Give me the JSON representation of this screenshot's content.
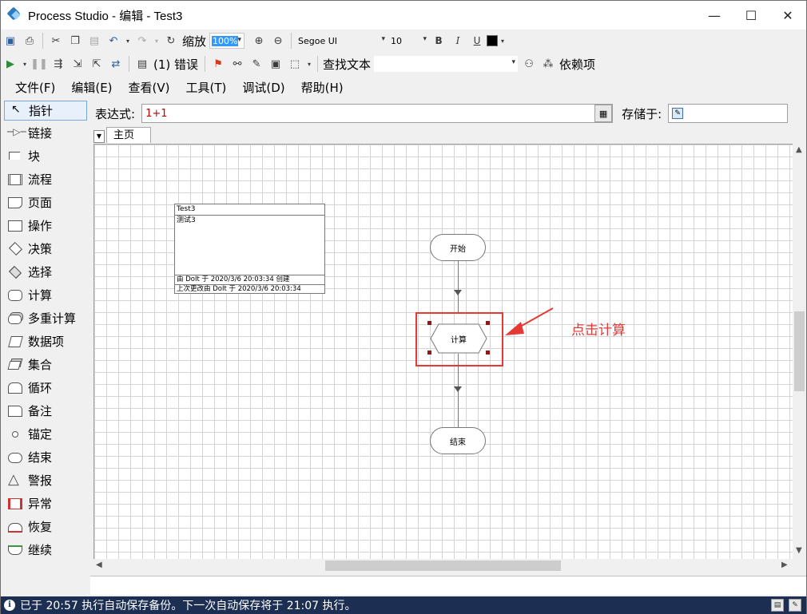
{
  "window": {
    "title": "Process Studio  - 编辑 - Test3",
    "minimize": "—",
    "maximize": "☐",
    "close": "✕"
  },
  "toolbar1": {
    "zoom_label": "缩放",
    "zoom_value": "100%",
    "font_name": "Segoe UI",
    "font_size": "10",
    "bold": "B",
    "italic": "I",
    "underline": "U"
  },
  "toolbar2": {
    "errors_label": "(1) 错误",
    "find_label": "查找文本",
    "find_value": "",
    "dependencies_label": "依赖项"
  },
  "menu": [
    "文件(F)",
    "编辑(E)",
    "查看(V)",
    "工具(T)",
    "调试(D)",
    "帮助(H)"
  ],
  "palette": [
    {
      "label": "指针",
      "icon": "pointer-icon"
    },
    {
      "label": "链接",
      "icon": "link-icon"
    },
    {
      "label": "块",
      "icon": "block-icon"
    },
    {
      "label": "流程",
      "icon": "process-icon"
    },
    {
      "label": "页面",
      "icon": "page-icon"
    },
    {
      "label": "操作",
      "icon": "action-icon"
    },
    {
      "label": "决策",
      "icon": "decision-icon"
    },
    {
      "label": "选择",
      "icon": "choice-icon"
    },
    {
      "label": "计算",
      "icon": "calculation-icon"
    },
    {
      "label": "多重计算",
      "icon": "multi-calculation-icon"
    },
    {
      "label": "数据项",
      "icon": "data-item-icon"
    },
    {
      "label": "集合",
      "icon": "collection-icon"
    },
    {
      "label": "循环",
      "icon": "loop-icon"
    },
    {
      "label": "备注",
      "icon": "note-icon"
    },
    {
      "label": "锚定",
      "icon": "anchor-icon"
    },
    {
      "label": "结束",
      "icon": "end-icon"
    },
    {
      "label": "警报",
      "icon": "alert-icon"
    },
    {
      "label": "异常",
      "icon": "exception-icon"
    },
    {
      "label": "恢复",
      "icon": "recover-icon"
    },
    {
      "label": "继续",
      "icon": "resume-icon"
    }
  ],
  "expression": {
    "label": "表达式:",
    "value": "1+1",
    "store_label": "存储于:",
    "store_value": ""
  },
  "tabs": [
    "主页"
  ],
  "canvas": {
    "info_box": {
      "title": "Test3",
      "description": "测试3",
      "created": "由 DoIt 于 2020/3/6  20:03:34 创建",
      "modified": "上次更改由 DoIt 于 2020/3/6 20:03:34"
    },
    "stages": {
      "start": "开始",
      "calc": "计算",
      "end": "结束"
    },
    "annotation": "点击计算"
  },
  "status": {
    "message": "已于 20:57 执行自动保存备份。下一次自动保存将于 21:07 执行。"
  },
  "colors": {
    "accent": "#e53935",
    "status_bg": "#1c2f52",
    "handle": "#8b1a1a"
  }
}
